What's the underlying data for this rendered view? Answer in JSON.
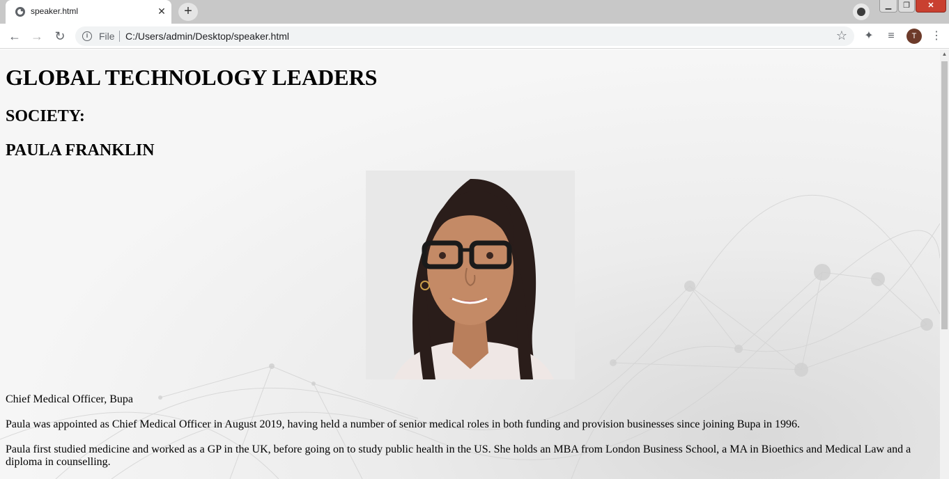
{
  "browser": {
    "tab_title": "speaker.html",
    "new_tab_label": "+",
    "close_tab_label": "✕",
    "address_scheme": "File",
    "address_url": "C:/Users/admin/Desktop/speaker.html",
    "profile_initial": "T",
    "icons": [
      "globe-icon",
      "close-icon",
      "plus-icon",
      "back-icon",
      "forward-icon",
      "reload-icon",
      "info-icon",
      "star-icon",
      "extensions-icon",
      "reading-list-icon",
      "menu-icon"
    ]
  },
  "page": {
    "heading": "GLOBAL TECHNOLOGY LEADERS",
    "section": "SOCIETY:",
    "speaker_name": "PAULA FRANKLIN",
    "role": "Chief Medical Officer, Bupa",
    "paragraph_1": "Paula was appointed as Chief Medical Officer in August 2019, having held a number of senior medical roles in both funding and provision businesses since joining Bupa in 1996.",
    "paragraph_2": "Paula first studied medicine and worked as a GP in the UK, before going on to study public health in the US. She holds an MBA from London Business School, a MA in Bioethics and Medical Law and a diploma in counselling."
  }
}
